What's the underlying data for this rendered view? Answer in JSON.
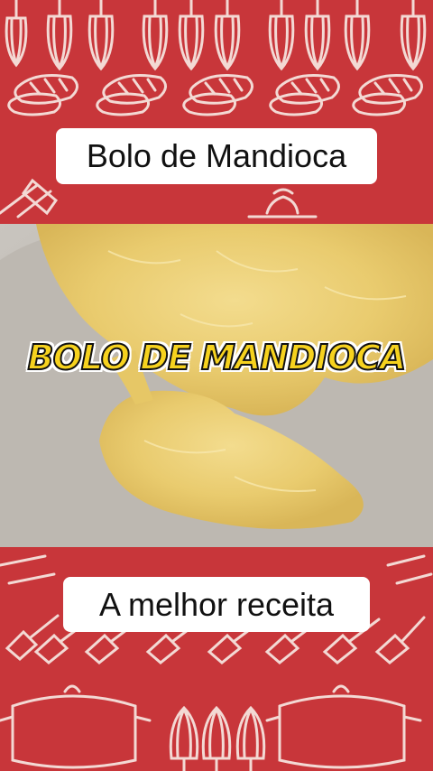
{
  "header": {
    "title": "Bolo de Mandioca"
  },
  "video": {
    "overlay_title": "BOLO DE MANDIOCA"
  },
  "footer": {
    "subtitle": "A melhor receita"
  },
  "colors": {
    "background": "#c8363a",
    "line_art": "#f3d9d4",
    "overlay_text": "#f6d21e"
  },
  "icons": [
    "whisk-icon",
    "bread-icon",
    "spatula-icon",
    "pot-icon"
  ]
}
